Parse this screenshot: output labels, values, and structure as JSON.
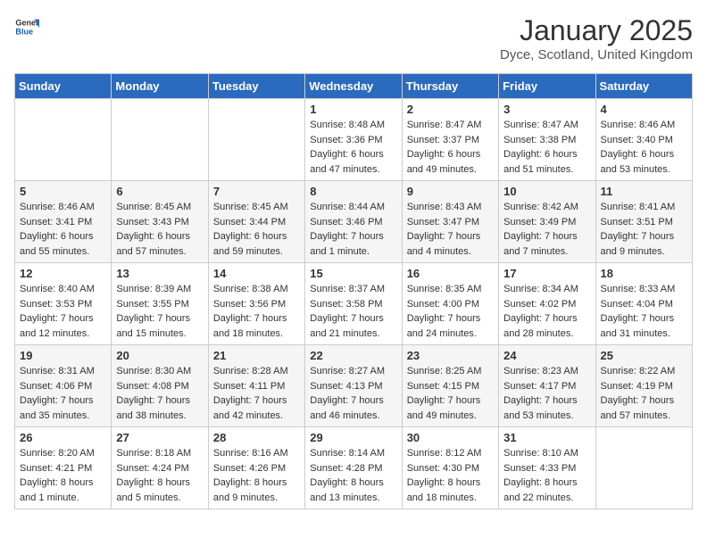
{
  "header": {
    "logo_general": "General",
    "logo_blue": "Blue",
    "month": "January 2025",
    "location": "Dyce, Scotland, United Kingdom"
  },
  "days_of_week": [
    "Sunday",
    "Monday",
    "Tuesday",
    "Wednesday",
    "Thursday",
    "Friday",
    "Saturday"
  ],
  "weeks": [
    [
      {
        "day": "",
        "info": ""
      },
      {
        "day": "",
        "info": ""
      },
      {
        "day": "",
        "info": ""
      },
      {
        "day": "1",
        "info": "Sunrise: 8:48 AM\nSunset: 3:36 PM\nDaylight: 6 hours and 47 minutes."
      },
      {
        "day": "2",
        "info": "Sunrise: 8:47 AM\nSunset: 3:37 PM\nDaylight: 6 hours and 49 minutes."
      },
      {
        "day": "3",
        "info": "Sunrise: 8:47 AM\nSunset: 3:38 PM\nDaylight: 6 hours and 51 minutes."
      },
      {
        "day": "4",
        "info": "Sunrise: 8:46 AM\nSunset: 3:40 PM\nDaylight: 6 hours and 53 minutes."
      }
    ],
    [
      {
        "day": "5",
        "info": "Sunrise: 8:46 AM\nSunset: 3:41 PM\nDaylight: 6 hours and 55 minutes."
      },
      {
        "day": "6",
        "info": "Sunrise: 8:45 AM\nSunset: 3:43 PM\nDaylight: 6 hours and 57 minutes."
      },
      {
        "day": "7",
        "info": "Sunrise: 8:45 AM\nSunset: 3:44 PM\nDaylight: 6 hours and 59 minutes."
      },
      {
        "day": "8",
        "info": "Sunrise: 8:44 AM\nSunset: 3:46 PM\nDaylight: 7 hours and 1 minute."
      },
      {
        "day": "9",
        "info": "Sunrise: 8:43 AM\nSunset: 3:47 PM\nDaylight: 7 hours and 4 minutes."
      },
      {
        "day": "10",
        "info": "Sunrise: 8:42 AM\nSunset: 3:49 PM\nDaylight: 7 hours and 7 minutes."
      },
      {
        "day": "11",
        "info": "Sunrise: 8:41 AM\nSunset: 3:51 PM\nDaylight: 7 hours and 9 minutes."
      }
    ],
    [
      {
        "day": "12",
        "info": "Sunrise: 8:40 AM\nSunset: 3:53 PM\nDaylight: 7 hours and 12 minutes."
      },
      {
        "day": "13",
        "info": "Sunrise: 8:39 AM\nSunset: 3:55 PM\nDaylight: 7 hours and 15 minutes."
      },
      {
        "day": "14",
        "info": "Sunrise: 8:38 AM\nSunset: 3:56 PM\nDaylight: 7 hours and 18 minutes."
      },
      {
        "day": "15",
        "info": "Sunrise: 8:37 AM\nSunset: 3:58 PM\nDaylight: 7 hours and 21 minutes."
      },
      {
        "day": "16",
        "info": "Sunrise: 8:35 AM\nSunset: 4:00 PM\nDaylight: 7 hours and 24 minutes."
      },
      {
        "day": "17",
        "info": "Sunrise: 8:34 AM\nSunset: 4:02 PM\nDaylight: 7 hours and 28 minutes."
      },
      {
        "day": "18",
        "info": "Sunrise: 8:33 AM\nSunset: 4:04 PM\nDaylight: 7 hours and 31 minutes."
      }
    ],
    [
      {
        "day": "19",
        "info": "Sunrise: 8:31 AM\nSunset: 4:06 PM\nDaylight: 7 hours and 35 minutes."
      },
      {
        "day": "20",
        "info": "Sunrise: 8:30 AM\nSunset: 4:08 PM\nDaylight: 7 hours and 38 minutes."
      },
      {
        "day": "21",
        "info": "Sunrise: 8:28 AM\nSunset: 4:11 PM\nDaylight: 7 hours and 42 minutes."
      },
      {
        "day": "22",
        "info": "Sunrise: 8:27 AM\nSunset: 4:13 PM\nDaylight: 7 hours and 46 minutes."
      },
      {
        "day": "23",
        "info": "Sunrise: 8:25 AM\nSunset: 4:15 PM\nDaylight: 7 hours and 49 minutes."
      },
      {
        "day": "24",
        "info": "Sunrise: 8:23 AM\nSunset: 4:17 PM\nDaylight: 7 hours and 53 minutes."
      },
      {
        "day": "25",
        "info": "Sunrise: 8:22 AM\nSunset: 4:19 PM\nDaylight: 7 hours and 57 minutes."
      }
    ],
    [
      {
        "day": "26",
        "info": "Sunrise: 8:20 AM\nSunset: 4:21 PM\nDaylight: 8 hours and 1 minute."
      },
      {
        "day": "27",
        "info": "Sunrise: 8:18 AM\nSunset: 4:24 PM\nDaylight: 8 hours and 5 minutes."
      },
      {
        "day": "28",
        "info": "Sunrise: 8:16 AM\nSunset: 4:26 PM\nDaylight: 8 hours and 9 minutes."
      },
      {
        "day": "29",
        "info": "Sunrise: 8:14 AM\nSunset: 4:28 PM\nDaylight: 8 hours and 13 minutes."
      },
      {
        "day": "30",
        "info": "Sunrise: 8:12 AM\nSunset: 4:30 PM\nDaylight: 8 hours and 18 minutes."
      },
      {
        "day": "31",
        "info": "Sunrise: 8:10 AM\nSunset: 4:33 PM\nDaylight: 8 hours and 22 minutes."
      },
      {
        "day": "",
        "info": ""
      }
    ]
  ]
}
